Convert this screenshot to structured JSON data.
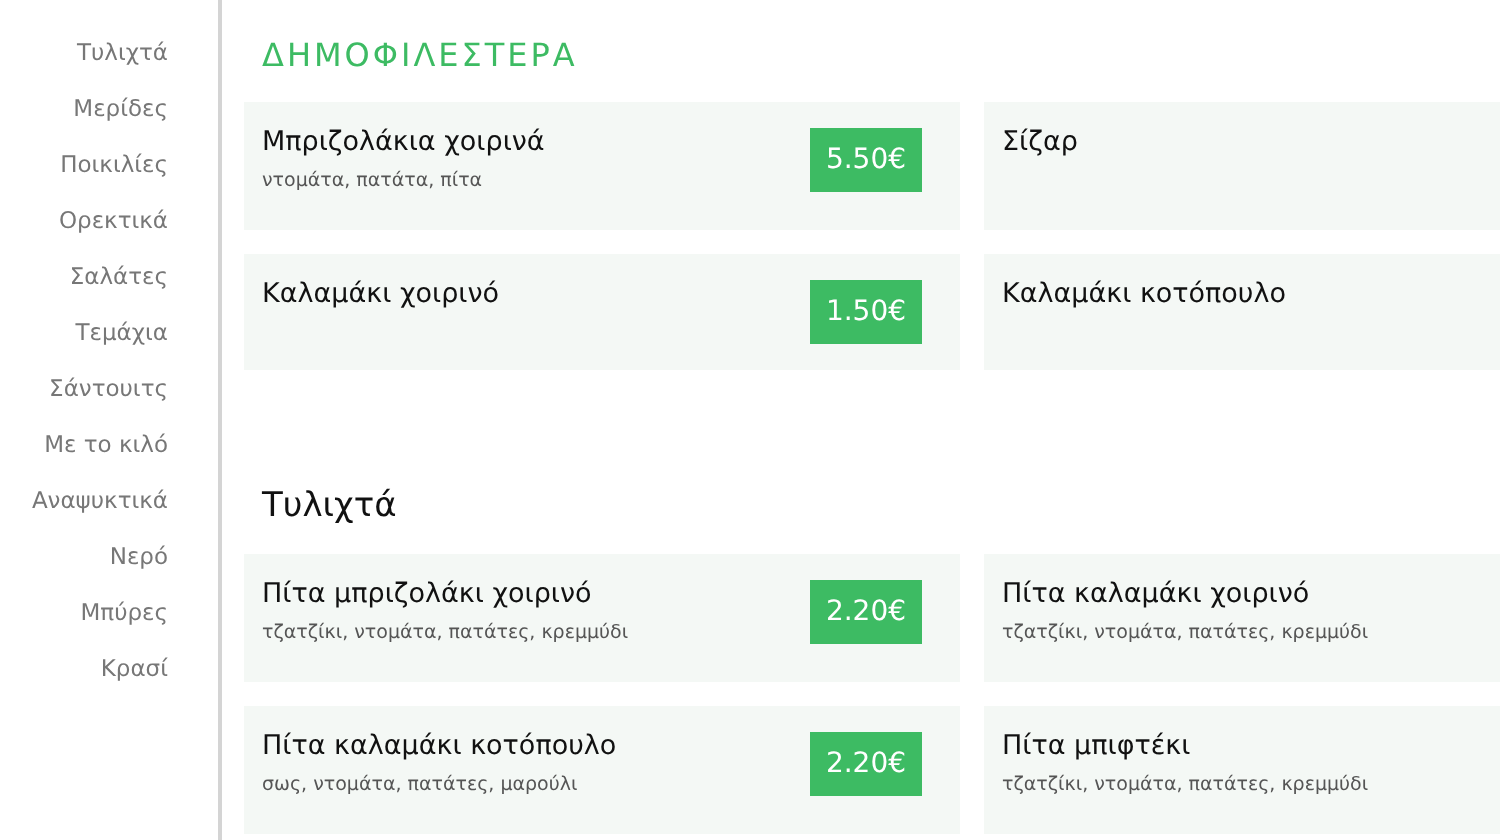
{
  "sidebar": {
    "items": [
      {
        "label": "Τυλιχτά"
      },
      {
        "label": "Μερίδες"
      },
      {
        "label": "Ποικιλίες"
      },
      {
        "label": "Ορεκτικά"
      },
      {
        "label": "Σαλάτες"
      },
      {
        "label": "Τεμάχια"
      },
      {
        "label": "Σάντουιτς"
      },
      {
        "label": "Με το κιλό"
      },
      {
        "label": "Αναψυκτικά"
      },
      {
        "label": "Νερό"
      },
      {
        "label": "Μπύρες"
      },
      {
        "label": "Κρασί"
      }
    ]
  },
  "sections": [
    {
      "kind": "featured",
      "title": "ΔΗΜΟΦΙΛΕΣΤΕΡΑ",
      "items": [
        {
          "name": "Μπριζολάκια χοιρινά",
          "description": "ντομάτα, πατάτα, πίτα",
          "price": "5.50€"
        },
        {
          "name": "Σίζαρ"
        },
        {
          "name": "Καλαμάκι χοιρινό",
          "price": "1.50€"
        },
        {
          "name": "Καλαμάκι κοτόπουλο"
        }
      ]
    },
    {
      "kind": "category",
      "title": "Τυλιχτά",
      "items": [
        {
          "name": "Πίτα μπριζολάκι χοιρινό",
          "description": "τζατζίκι, ντομάτα, πατάτες, κρεμμύδι",
          "price": "2.20€"
        },
        {
          "name": "Πίτα καλαμάκι χοιρινό",
          "description": "τζατζίκι, ντομάτα, πατάτες, κρεμμύδι"
        },
        {
          "name": "Πίτα καλαμάκι κοτόπουλο",
          "description": "σως, ντομάτα, πατάτες, μαρούλι",
          "price": "2.20€"
        },
        {
          "name": "Πίτα μπιφτέκι",
          "description": "τζατζίκι, ντομάτα, πατάτες, κρεμμύδι"
        }
      ]
    }
  ]
}
